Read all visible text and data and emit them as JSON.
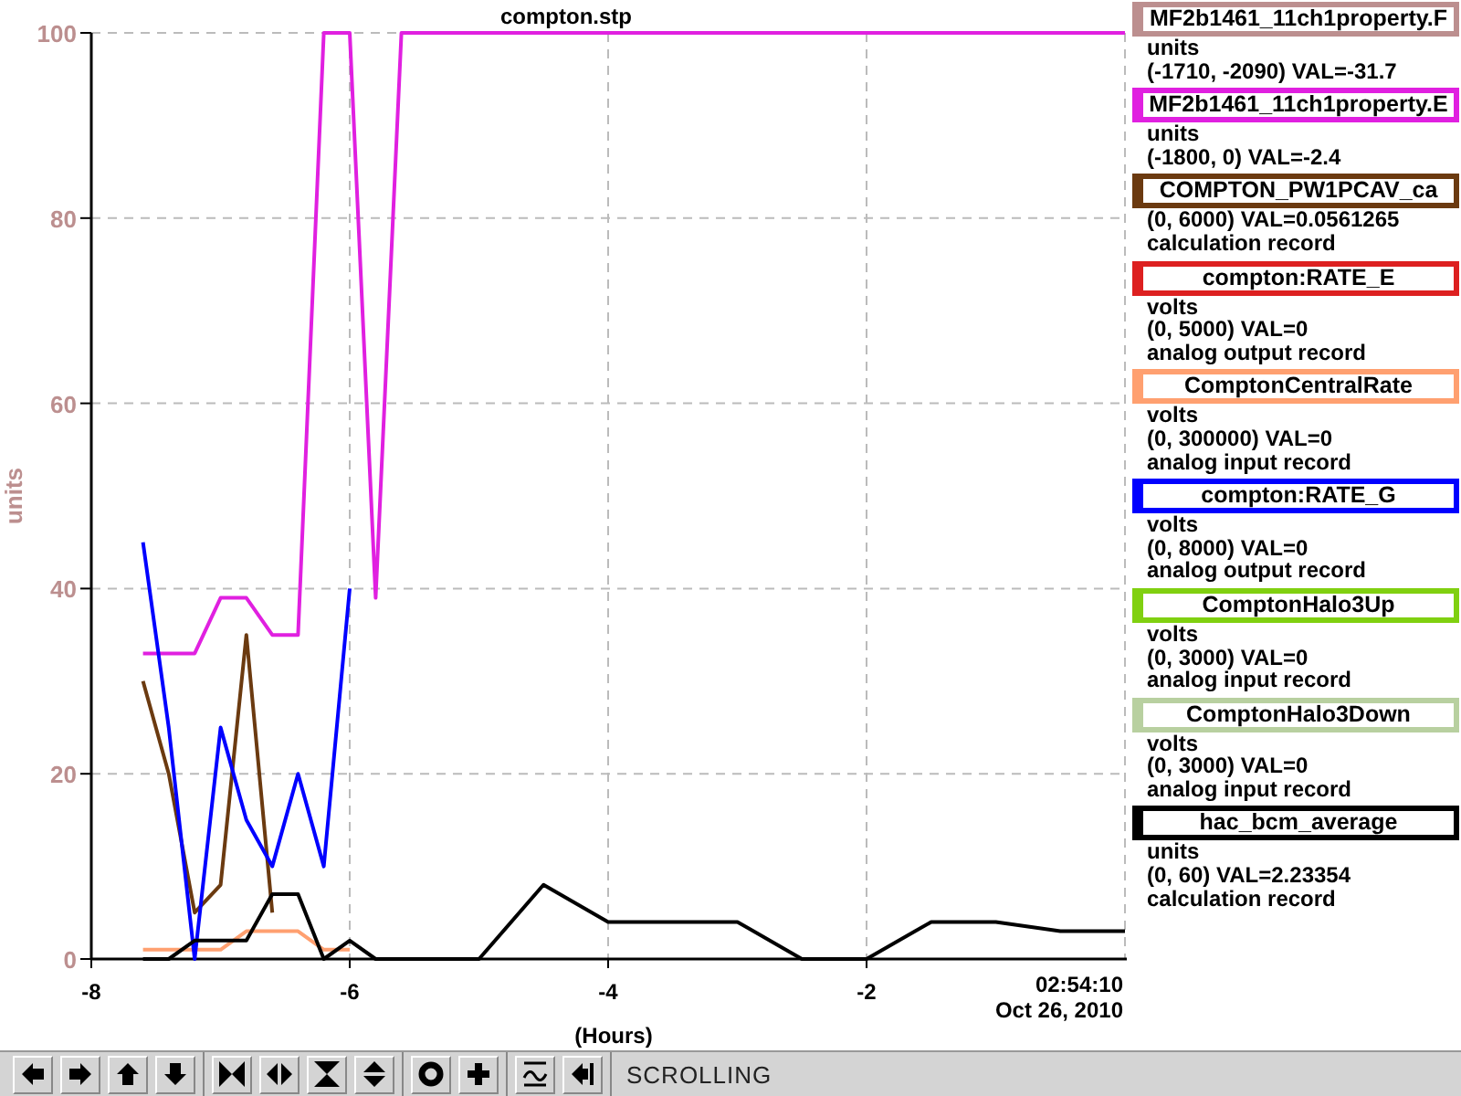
{
  "plot": {
    "chart_data": {
      "type": "line",
      "title": "compton.stp",
      "xlabel": "(Hours)",
      "ylabel": "units",
      "xlim": [
        -8,
        0
      ],
      "ylim": [
        0,
        100
      ],
      "xticks": [
        -8,
        -6,
        -4,
        -2
      ],
      "yticks": [
        0,
        20,
        40,
        60,
        80,
        100
      ],
      "grid": true,
      "x": [
        -7.6,
        -7.4,
        -7.2,
        -7.0,
        -6.8,
        -6.6,
        -6.4,
        -6.2,
        -6.0,
        -5.8,
        -5.6,
        -5.0,
        -4.5,
        -4.0,
        -3.5,
        -3.0,
        -2.5,
        -2.0,
        -1.5,
        -1.0,
        -0.5,
        0
      ],
      "series": [
        {
          "name": "MF2b1461_11ch1property.F",
          "color": "#bc8f8f",
          "values": [
            null,
            null,
            null,
            null,
            null,
            null,
            null,
            null,
            null,
            null,
            null,
            null,
            null,
            null,
            null,
            null,
            null,
            null,
            null,
            null,
            null,
            null
          ]
        },
        {
          "name": "MF2b1461_11ch1property.E",
          "color": "#e020e0",
          "values": [
            33,
            33,
            33,
            39,
            39,
            35,
            35,
            100,
            100,
            39,
            100,
            100,
            100,
            100,
            100,
            100,
            100,
            100,
            100,
            100,
            100,
            100
          ]
        },
        {
          "name": "COMPTON_PW1PCAV_ca",
          "color": "#6b3a10",
          "values": [
            30,
            20,
            5,
            8,
            35,
            5,
            null,
            null,
            null,
            null,
            null,
            null,
            null,
            null,
            null,
            null,
            null,
            null,
            null,
            null,
            null,
            null
          ]
        },
        {
          "name": "compton:RATE_E",
          "color": "#dd2020",
          "values": [
            null,
            null,
            null,
            null,
            null,
            null,
            null,
            null,
            null,
            null,
            null,
            null,
            null,
            null,
            null,
            null,
            null,
            null,
            null,
            null,
            null,
            null
          ]
        },
        {
          "name": "ComptonCentralRate",
          "color": "#ffa070",
          "values": [
            1,
            1,
            1,
            1,
            3,
            3,
            3,
            1,
            1,
            null,
            null,
            null,
            null,
            null,
            null,
            null,
            null,
            null,
            null,
            null,
            null,
            null
          ]
        },
        {
          "name": "compton:RATE_G",
          "color": "#0000ff",
          "values": [
            45,
            25,
            0,
            25,
            15,
            10,
            20,
            10,
            40,
            null,
            null,
            null,
            null,
            null,
            null,
            null,
            null,
            null,
            null,
            null,
            null,
            null
          ]
        },
        {
          "name": "ComptonHalo3Up",
          "color": "#80d010",
          "values": [
            null,
            null,
            null,
            null,
            null,
            null,
            null,
            null,
            null,
            null,
            null,
            null,
            null,
            null,
            null,
            null,
            null,
            null,
            null,
            null,
            null,
            null
          ]
        },
        {
          "name": "ComptonHalo3Down",
          "color": "#b8d0a0",
          "values": [
            null,
            null,
            null,
            null,
            null,
            null,
            null,
            null,
            null,
            null,
            null,
            null,
            null,
            null,
            null,
            null,
            null,
            null,
            null,
            null,
            null,
            null
          ]
        },
        {
          "name": "hac_bcm_average",
          "color": "#000000",
          "values": [
            0,
            0,
            2,
            2,
            2,
            7,
            7,
            0,
            2,
            0,
            0,
            0,
            8,
            4,
            4,
            4,
            0,
            0,
            4,
            4,
            3,
            3
          ]
        }
      ]
    },
    "timestamp": "02:54:10",
    "date": "Oct 26, 2010"
  },
  "legend": [
    {
      "units": "units",
      "range": "(-1710, -2090) VAL=-31.7"
    },
    {
      "units": "units",
      "range": "(-1800, 0) VAL=-2.4"
    },
    {
      "range": "(0, 6000) VAL=0.0561265",
      "description": "calculation record"
    },
    {
      "units": "volts",
      "range": "(0, 5000)  VAL=0",
      "description": "analog output record"
    },
    {
      "units": "volts",
      "range": "(0, 300000) VAL=0",
      "description": "analog input record"
    },
    {
      "units": "volts",
      "range": "(0, 8000) VAL=0",
      "description": "analog output record"
    },
    {
      "units": "volts",
      "range": "(0, 3000)  VAL=0",
      "description": "analog input record"
    },
    {
      "units": "volts",
      "range": "(0, 3000)  VAL=0",
      "description": "analog input record"
    },
    {
      "units": "units",
      "range": "(0, 60) VAL=2.23354",
      "description": "calculation record"
    }
  ],
  "toolbar": {
    "mode": "SCROLLING"
  }
}
